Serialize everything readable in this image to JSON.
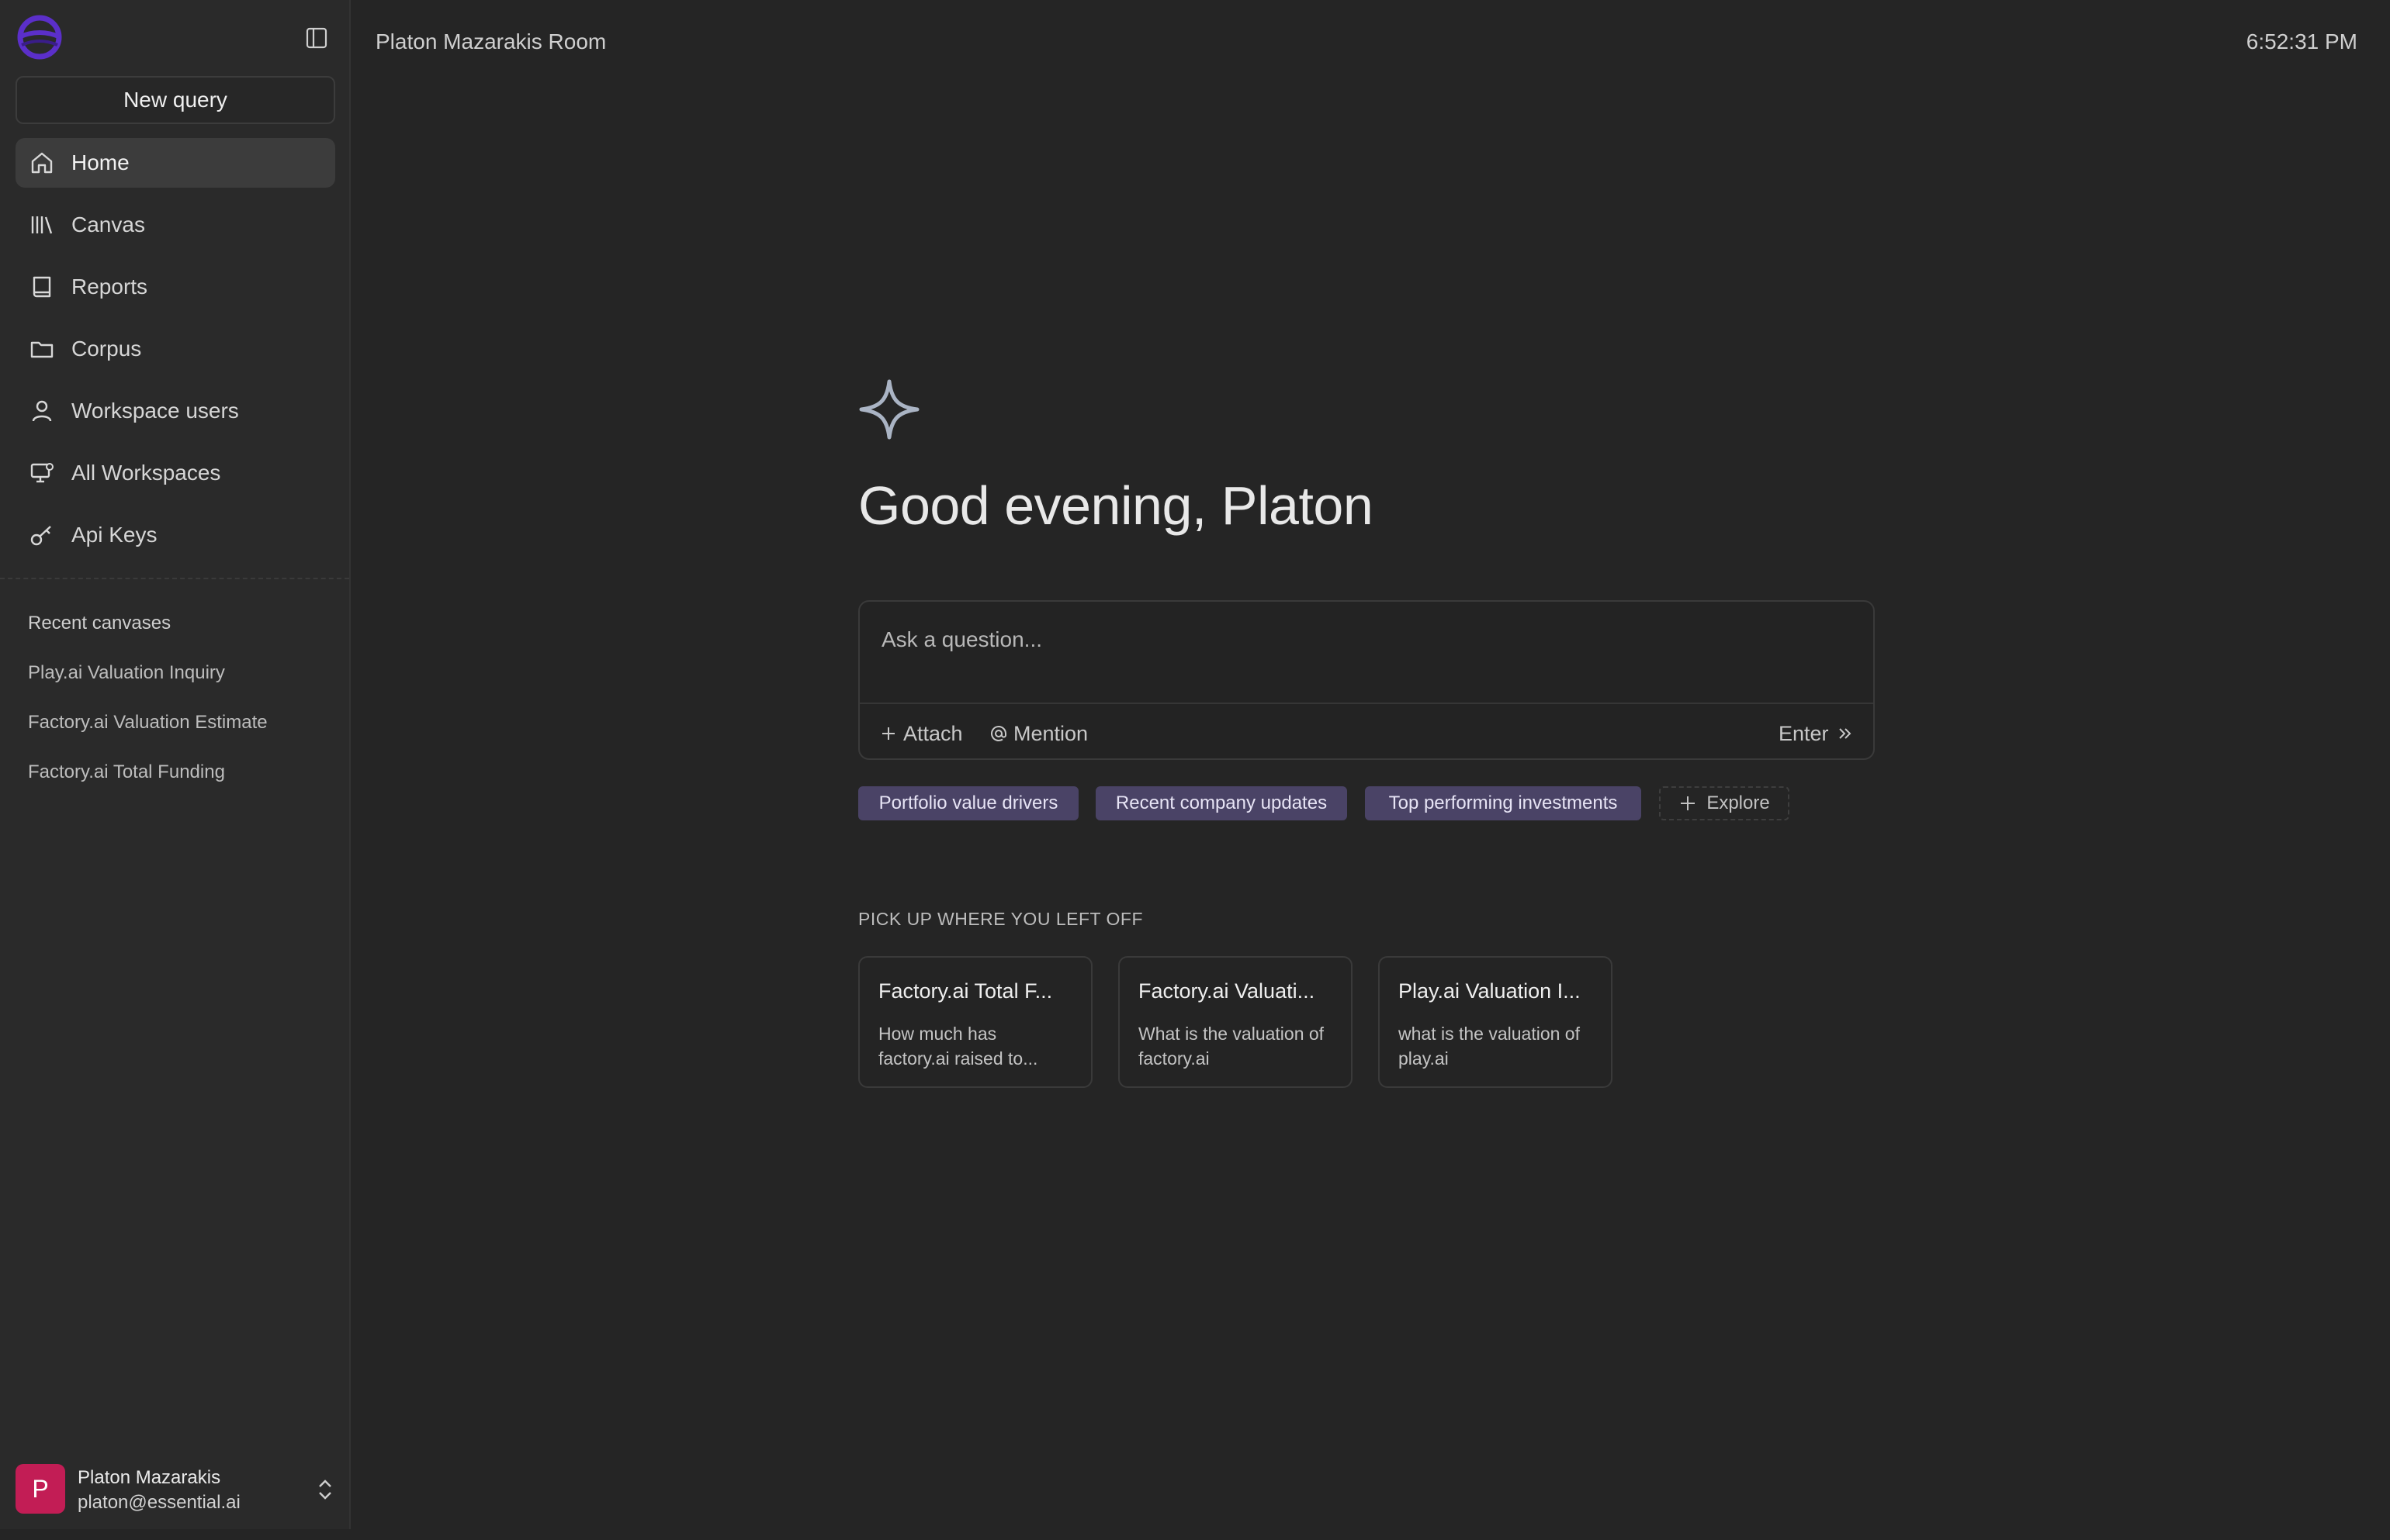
{
  "header": {
    "room_title": "Platon Mazarakis Room",
    "time": "6:52:31 PM"
  },
  "sidebar": {
    "new_query_label": "New query",
    "items": [
      {
        "label": "Home",
        "icon": "home-icon",
        "active": true
      },
      {
        "label": "Canvas",
        "icon": "library-icon"
      },
      {
        "label": "Reports",
        "icon": "book-icon"
      },
      {
        "label": "Corpus",
        "icon": "folder-icon"
      },
      {
        "label": "Workspace users",
        "icon": "user-icon"
      },
      {
        "label": "All Workspaces",
        "icon": "monitor-icon"
      },
      {
        "label": "Api Keys",
        "icon": "key-icon"
      }
    ],
    "recent_title": "Recent canvases",
    "recent": [
      "Play.ai Valuation Inquiry",
      "Factory.ai Valuation Estimate",
      "Factory.ai Total Funding"
    ],
    "user": {
      "initial": "P",
      "name": "Platon Mazarakis",
      "email": "platon@essential.ai"
    }
  },
  "main": {
    "greeting": "Good evening, Platon",
    "composer": {
      "placeholder": "Ask a question...",
      "attach_label": "Attach",
      "mention_label": "Mention",
      "enter_label": "Enter"
    },
    "suggestions": [
      "Portfolio value drivers",
      "Recent company updates",
      "Top performing investments"
    ],
    "explore_label": "Explore",
    "pickup_title": "PICK UP WHERE YOU LEFT OFF",
    "cards": [
      {
        "title": "Factory.ai Total F...",
        "desc": "How much has factory.ai raised to..."
      },
      {
        "title": "Factory.ai Valuati...",
        "desc": "What is the valuation of factory.ai"
      },
      {
        "title": "Play.ai Valuation I...",
        "desc": "what is the valuation of play.ai"
      }
    ]
  },
  "colors": {
    "background": "#252525",
    "sidebar": "#2a2a2a",
    "chip": "#4a4366",
    "avatar": "#c21d55",
    "logo": "#5b2fc9"
  }
}
